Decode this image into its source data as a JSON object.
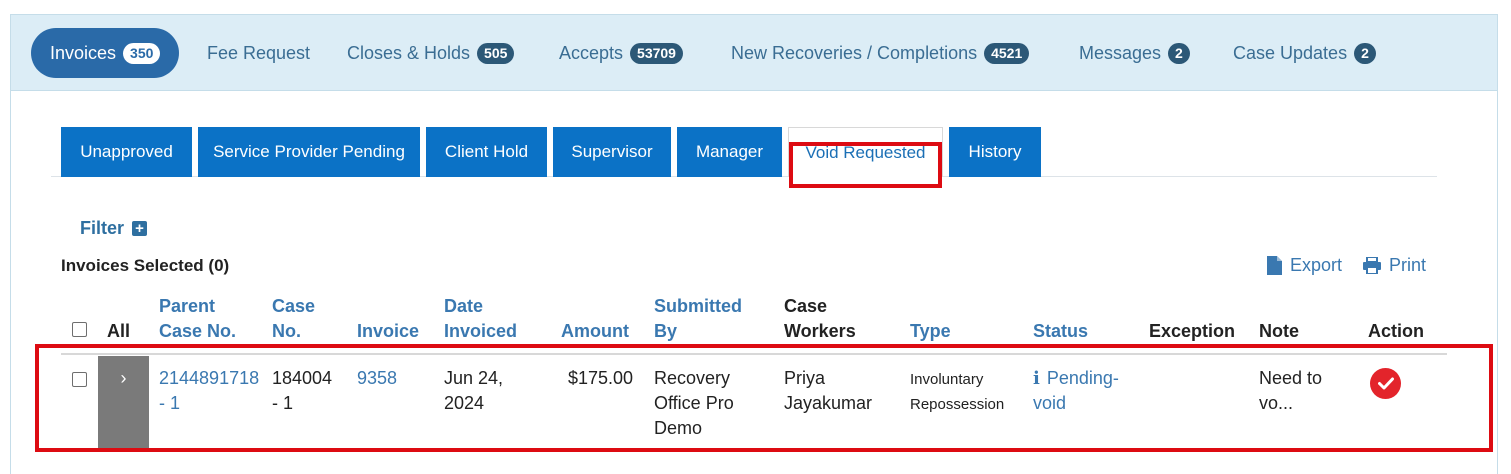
{
  "top_tabs": [
    {
      "label": "Invoices",
      "count": "350",
      "active": true
    },
    {
      "label": "Fee Request"
    },
    {
      "label": "Closes & Holds",
      "count": "505"
    },
    {
      "label": "Accepts",
      "count": "53709"
    },
    {
      "label": "New Recoveries / Completions",
      "count": "4521"
    },
    {
      "label": "Messages",
      "count": "2"
    },
    {
      "label": "Case Updates",
      "count": "2"
    }
  ],
  "sub_tabs": [
    "Unapproved",
    "Service Provider Pending",
    "Client Hold",
    "Supervisor",
    "Manager",
    "Void Requested",
    "History"
  ],
  "active_sub_tab": "Void Requested",
  "filter_label": "Filter",
  "selected_label": "Invoices Selected (0)",
  "tools": {
    "export": "Export",
    "print": "Print"
  },
  "columns": {
    "all": "All",
    "parent_case_1": "Parent",
    "parent_case_2": "Case No.",
    "case_1": "Case",
    "case_2": "No.",
    "invoice": "Invoice",
    "date_1": "Date",
    "date_2": "Invoiced",
    "amount": "Amount",
    "submitted_1": "Submitted",
    "submitted_2": "By",
    "workers_1": "Case",
    "workers_2": "Workers",
    "type": "Type",
    "status": "Status",
    "exception": "Exception",
    "note": "Note",
    "action": "Action"
  },
  "row": {
    "expander": "›",
    "parent_case_1": "2144891718",
    "parent_case_2": "- 1",
    "case_1": "184004",
    "case_2": "- 1",
    "invoice": "9358",
    "date_1": "Jun 24,",
    "date_2": "2024",
    "amount": "$175.00",
    "submitted_1": "Recovery",
    "submitted_2": "Office Pro",
    "submitted_3": "Demo",
    "workers_1": "Priya",
    "workers_2": "Jayakumar",
    "type_1": "Involuntary",
    "type_2": "Repossession",
    "status_icon": "info-icon",
    "status_1": "Pending-",
    "status_2": "void",
    "exception": "",
    "note_1": "Need to",
    "note_2": "vo...",
    "action_icon": "check-icon"
  },
  "colors": {
    "accent": "#0b72c6",
    "highlight": "#dd0b12",
    "action": "#e3242b",
    "link": "#3a78b0"
  }
}
